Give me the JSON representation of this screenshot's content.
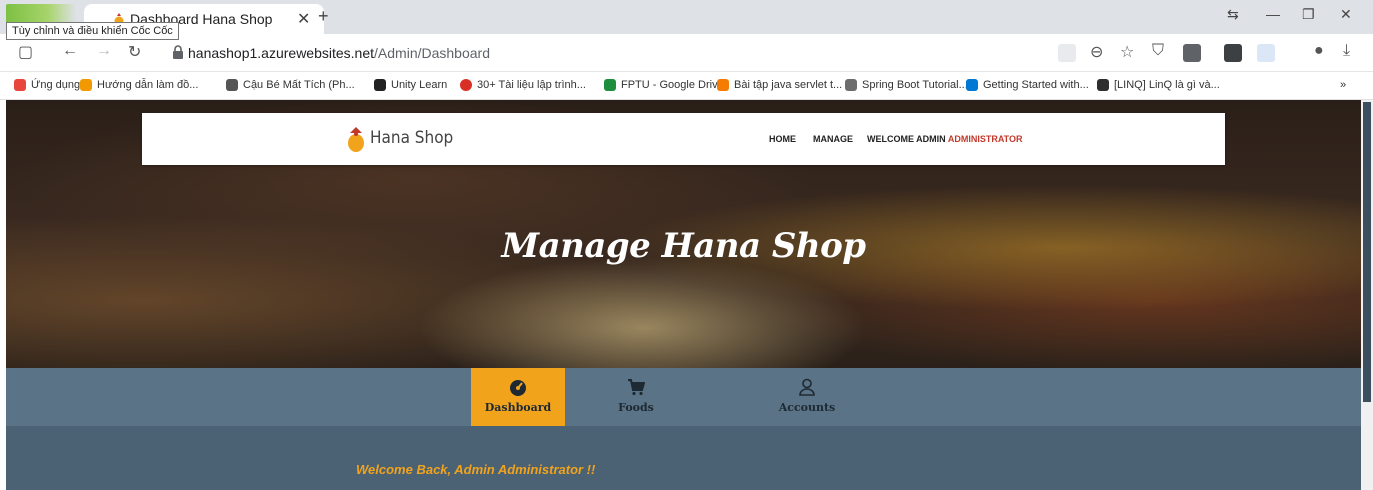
{
  "browser": {
    "tab_title": "Dashboard Hana Shop",
    "tab_close": "✕",
    "new_tab": "+",
    "tooltip": "Tùy chỉnh và điều khiển Cốc Cốc",
    "url_host": "hanashop1.azurewebsites.net",
    "url_path": "/Admin/Dashboard",
    "bookmarks": [
      {
        "label": "Ứng dụng",
        "color": "#e8453c"
      },
      {
        "label": "Hướng dẫn làm đồ...",
        "color": "#f29900"
      },
      {
        "label": "Cậu Bé Mất Tích (Ph...",
        "color": "#555555"
      },
      {
        "label": "Unity Learn",
        "color": "#222222"
      },
      {
        "label": "30+ Tài liệu lập trình...",
        "color": "#d93025"
      },
      {
        "label": "FPTU - Google Drive",
        "color": "#1e8e3e"
      },
      {
        "label": "Bài tập java servlet t...",
        "color": "#f57c00"
      },
      {
        "label": "Spring Boot Tutorial...",
        "color": "#6d6d6d"
      },
      {
        "label": "Getting Started with...",
        "color": "#0078d4"
      },
      {
        "label": "[LINQ] LinQ là gì và...",
        "color": "#2e2e2e"
      }
    ],
    "bookmarks_overflow": "»"
  },
  "navbar": {
    "brand": "Hana Shop",
    "home": "HOME",
    "manage": "MANAGE",
    "welcome_prefix": "WELCOME ADMIN",
    "welcome_role": "ADMINISTRATOR"
  },
  "hero": {
    "title": "Manage Hana Shop"
  },
  "admin_tabs": [
    {
      "label": "Dashboard",
      "icon": "dashboard-icon",
      "active": true
    },
    {
      "label": "Foods",
      "icon": "cart-icon",
      "active": false
    },
    {
      "label": "Accounts",
      "icon": "user-icon",
      "active": false
    }
  ],
  "content": {
    "welcome_message": "Welcome Back, Admin Administrator !!"
  },
  "colors": {
    "accent": "#f2a31c",
    "tab_bar": "#5a7386",
    "content_bg": "#4a6274",
    "role_red": "#c0392b",
    "welcome_text": "#f2a31c"
  }
}
